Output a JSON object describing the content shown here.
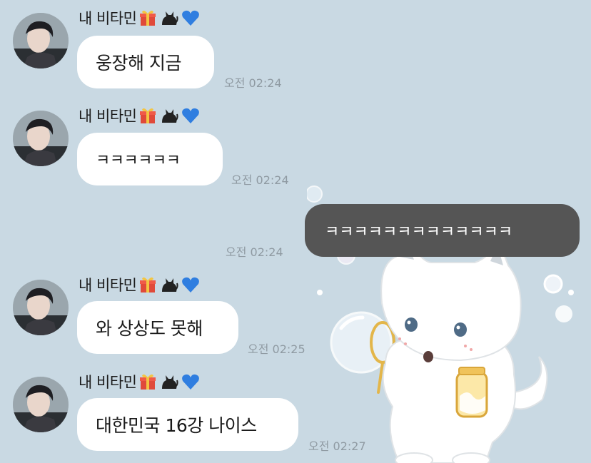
{
  "chat": {
    "sender_name": "내 비타민",
    "sender_emojis": [
      "gift-icon",
      "black-cat-icon",
      "blue-heart-icon"
    ],
    "messages": [
      {
        "from": "other",
        "text": "웅장해 지금",
        "time": "오전 02:24"
      },
      {
        "from": "other",
        "text": "ㅋㅋㅋㅋㅋㅋ",
        "time": "오전 02:24"
      },
      {
        "from": "me",
        "text": "ㅋㅋㅋㅋㅋㅋㅋㅋㅋㅋㅋㅋㅋ",
        "time": "오전 02:24"
      },
      {
        "from": "other",
        "text": "와 상상도 못해",
        "time": "오전 02:25"
      },
      {
        "from": "other",
        "text": "대한민국 16강 나이스",
        "time": "오전 02:27"
      }
    ]
  },
  "colors": {
    "background": "#c9d9e3",
    "incoming_bubble": "#ffffff",
    "outgoing_bubble": "#555555",
    "timestamp": "#8f9aa2"
  },
  "background_image": "white-cat-blowing-bubbles"
}
